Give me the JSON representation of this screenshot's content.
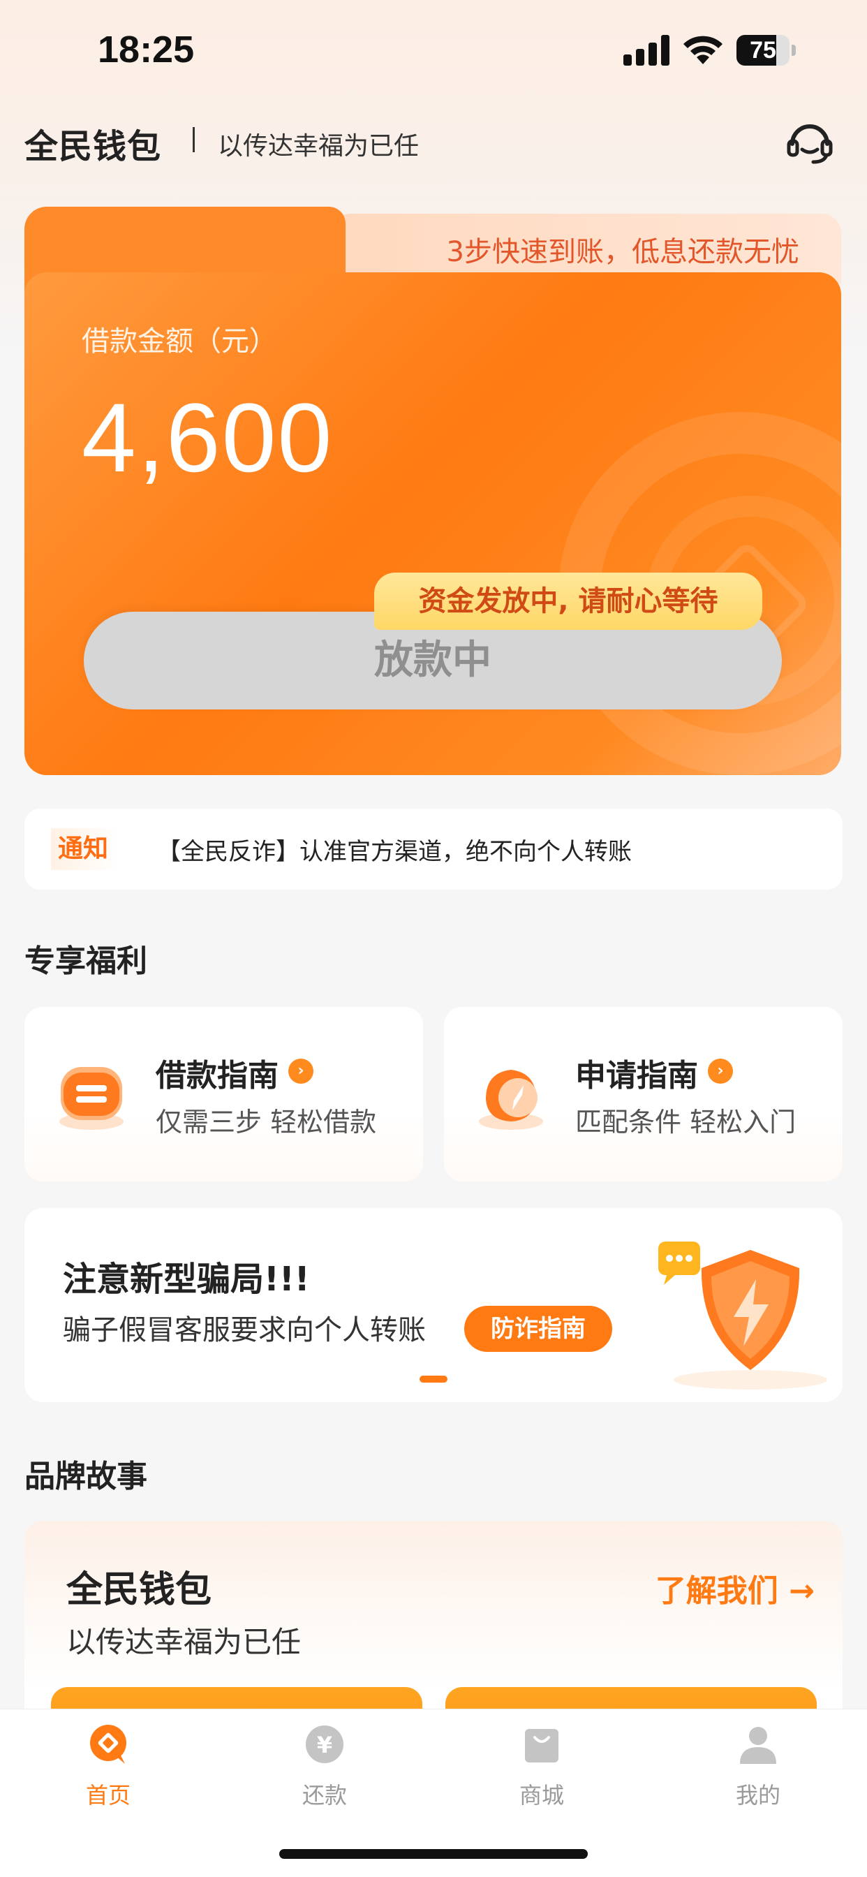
{
  "status_bar": {
    "time": "18:25",
    "battery": "75",
    "battery_level": 0.75
  },
  "header": {
    "brand": "全民钱包",
    "slogan": "以传达幸福为已任"
  },
  "hero": {
    "ribbon_text": "3步快速到账，低息还款无忧",
    "amount_label": "借款金额（元）",
    "amount_value": "4,600",
    "tip_text": "资金发放中, 请耐心等待",
    "button_label": "放款中"
  },
  "notice": {
    "tag": "通知",
    "text": "【全民反诈】认准官方渠道，绝不向个人转账"
  },
  "benefits": {
    "section_title": "专享福利",
    "items": [
      {
        "title": "借款指南",
        "subtitle": "仅需三步 轻松借款"
      },
      {
        "title": "申请指南",
        "subtitle": "匹配条件 轻松入门"
      }
    ]
  },
  "fraud_banner": {
    "title": "注意新型骗局!!!",
    "subtitle": "骗子假冒客服要求向个人转账",
    "button_label": "防诈指南"
  },
  "brand_story": {
    "section_title": "品牌故事",
    "title": "全民钱包",
    "subtitle": "以传达幸福为已任",
    "link_label": "了解我们 →"
  },
  "tabbar": {
    "items": [
      {
        "label": "首页",
        "icon": "home-icon",
        "active": true
      },
      {
        "label": "还款",
        "icon": "yuan-icon",
        "active": false
      },
      {
        "label": "商城",
        "icon": "shopping-bag-icon",
        "active": false
      },
      {
        "label": "我的",
        "icon": "profile-icon",
        "active": false
      }
    ]
  },
  "colors": {
    "accent": "#ff7a12",
    "ribbon_text": "#e2562a",
    "tip_bg": "#ffd766",
    "button_disabled": "#d6d6d6"
  }
}
